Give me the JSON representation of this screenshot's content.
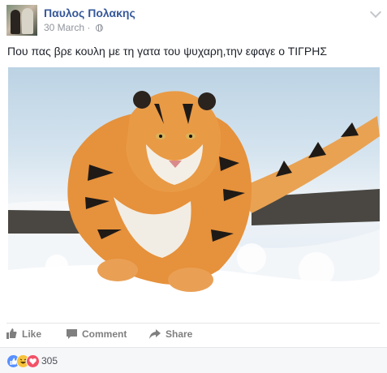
{
  "post": {
    "author": "Παυλος Πολακης",
    "date": "30 March",
    "separator": "·",
    "text": "Που πας βρε κουλη με τη γατα του ψυχαρη,την εφαγε ο ΤΙΓΡΗΣ",
    "privacy_icon": "globe-icon",
    "menu_icon": "chevron-down-icon",
    "image_subject": "tiger-running-in-snow"
  },
  "actions": {
    "like_label": "Like",
    "comment_label": "Comment",
    "share_label": "Share"
  },
  "reactions": {
    "icons": [
      "like-reaction-icon",
      "haha-reaction-icon",
      "love-reaction-icon"
    ],
    "count": "305"
  },
  "colors": {
    "link_blue": "#365899",
    "meta_gray": "#90949c",
    "action_gray": "#7f7f7f",
    "like_blue": "#5890ff",
    "haha_yellow": "#f7c33b",
    "love_red": "#f25268"
  }
}
